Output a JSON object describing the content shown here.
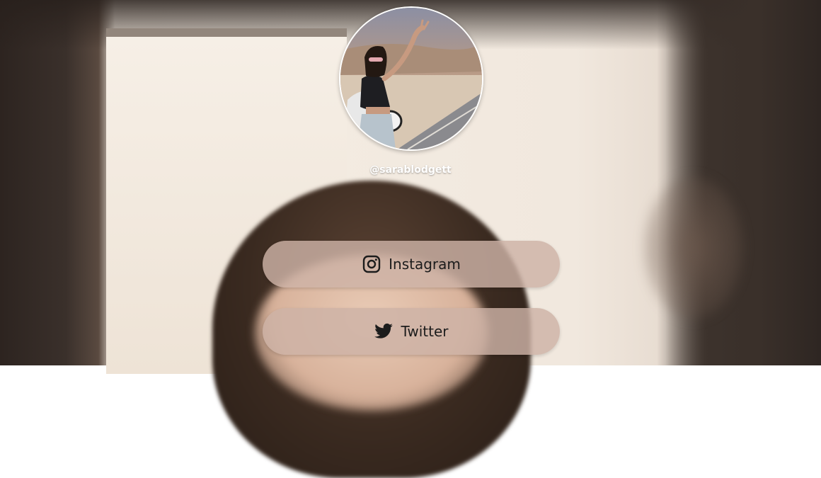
{
  "profile": {
    "handle": "@sarablodgett"
  },
  "links": [
    {
      "label": "Instagram",
      "icon": "instagram-icon"
    },
    {
      "label": "Twitter",
      "icon": "twitter-icon"
    }
  ],
  "colors": {
    "button_bg": "#cdb2a6",
    "button_text": "#1c1c1c",
    "handle_text": "#ffffff"
  }
}
